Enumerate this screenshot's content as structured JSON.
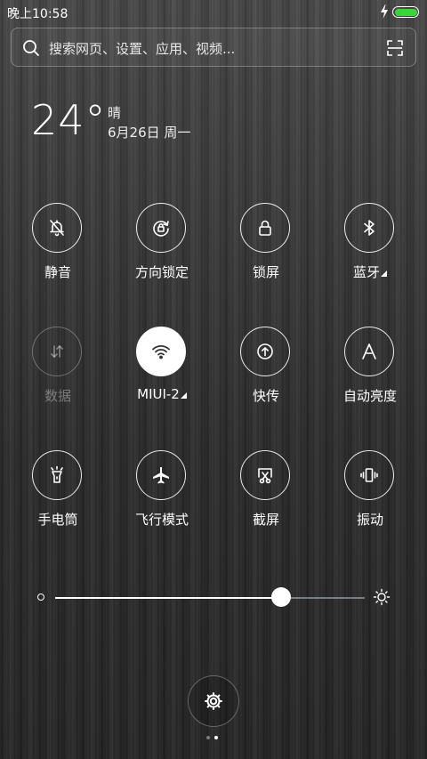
{
  "status_bar": {
    "time": "晚上10:58",
    "battery_percent": 100,
    "charging": true
  },
  "search": {
    "placeholder": "搜索网页、设置、应用、视频..."
  },
  "weather": {
    "temperature": "24°",
    "condition": "晴",
    "date": "6月26日 周一"
  },
  "toggles": [
    {
      "label": "静音",
      "icon": "bell-off-icon",
      "state": "off"
    },
    {
      "label": "方向锁定",
      "icon": "rotation-lock-icon",
      "state": "off"
    },
    {
      "label": "锁屏",
      "icon": "lock-icon",
      "state": "off"
    },
    {
      "label": "蓝牙",
      "icon": "bluetooth-icon",
      "state": "off",
      "has_submenu": true
    },
    {
      "label": "数据",
      "icon": "data-arrows-icon",
      "state": "disabled"
    },
    {
      "label": "MIUI-2",
      "icon": "wifi-icon",
      "state": "on",
      "has_submenu": true
    },
    {
      "label": "快传",
      "icon": "share-upload-icon",
      "state": "off"
    },
    {
      "label": "自动亮度",
      "icon": "auto-brightness-icon",
      "state": "off"
    },
    {
      "label": "手电筒",
      "icon": "flashlight-icon",
      "state": "off"
    },
    {
      "label": "飞行模式",
      "icon": "airplane-icon",
      "state": "off"
    },
    {
      "label": "截屏",
      "icon": "screenshot-icon",
      "state": "off"
    },
    {
      "label": "振动",
      "icon": "vibrate-icon",
      "state": "off"
    }
  ],
  "brightness": {
    "level": 0.73
  },
  "settings": {
    "icon": "gear-icon"
  },
  "pager": {
    "count": 2,
    "active": 1
  },
  "colors": {
    "battery": "#3dd13d",
    "track_inactive": "#b4bedc"
  }
}
